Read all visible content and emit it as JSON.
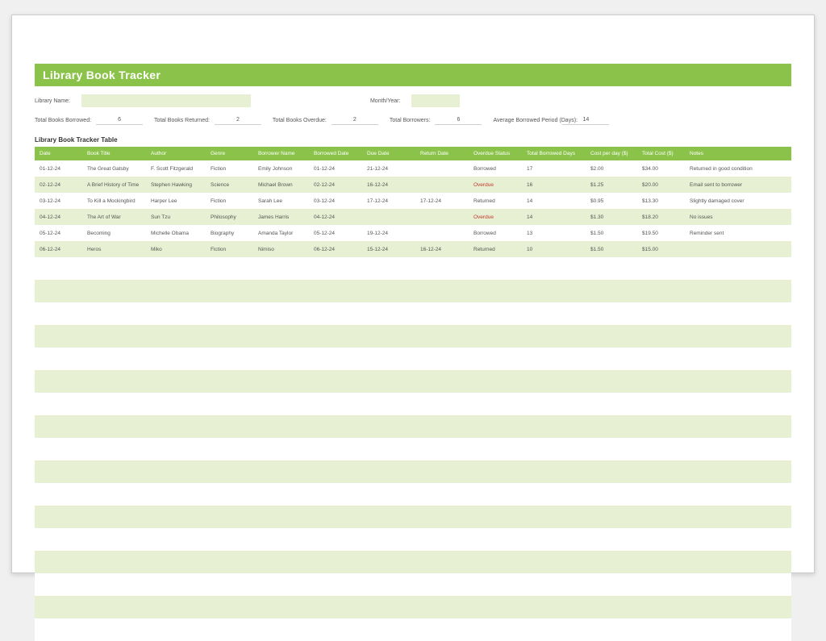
{
  "title": "Library Book Tracker",
  "info": {
    "library_name_label": "Library Name:",
    "library_name_value": "",
    "month_year_label": "Month/Year:",
    "month_year_value": ""
  },
  "stats": {
    "total_borrowed_label": "Total Books Borrowed:",
    "total_borrowed_value": "6",
    "total_returned_label": "Total Books Returned:",
    "total_returned_value": "2",
    "total_overdue_label": "Total Books Overdue:",
    "total_overdue_value": "2",
    "total_borrowers_label": "Total Borrowers:",
    "total_borrowers_value": "6",
    "avg_period_label": "Average Borrowed Period (Days):",
    "avg_period_value": "14"
  },
  "table_title": "Library Book Tracker Table",
  "columns": {
    "date": "Date",
    "title": "Book Title",
    "author": "Author",
    "genre": "Genre",
    "borrower": "Borrower Name",
    "borrowed_date": "Borrowed Date",
    "due_date": "Due Date",
    "return_date": "Return Date",
    "overdue_status": "Overdue Status",
    "borrowed_days": "Total Borrowed Days",
    "cost_per_day": "Cost per day ($)",
    "total_cost": "Total Cost ($)",
    "notes": "Notes"
  },
  "rows": [
    {
      "date": "01-12-24",
      "title": "The Great Gatsby",
      "author": "F. Scott Fitzgerald",
      "genre": "Fiction",
      "borrower": "Emily Johnson",
      "bdate": "01-12-24",
      "ddate": "21-12-24",
      "rdate": "",
      "status": "Borrowed",
      "days": "17",
      "cost": "$2.00",
      "total": "$34.00",
      "notes": "Returned in good condition"
    },
    {
      "date": "02-12-24",
      "title": "A Brief History of Time",
      "author": "Stephen Hawking",
      "genre": "Science",
      "borrower": "Michael Brown",
      "bdate": "02-12-24",
      "ddate": "16-12-24",
      "rdate": "",
      "status": "Overdue",
      "days": "16",
      "cost": "$1.25",
      "total": "$20.00",
      "notes": "Email sent to borrower"
    },
    {
      "date": "03-12-24",
      "title": "To Kill a Mockingbird",
      "author": "Harper Lee",
      "genre": "Fiction",
      "borrower": "Sarah Lee",
      "bdate": "03-12-24",
      "ddate": "17-12-24",
      "rdate": "17-12-24",
      "status": "Returned",
      "days": "14",
      "cost": "$0.95",
      "total": "$13.30",
      "notes": "Slightly damaged cover"
    },
    {
      "date": "04-12-24",
      "title": "The Art of War",
      "author": "Sun Tzu",
      "genre": "Philosophy",
      "borrower": "James Harris",
      "bdate": "04-12-24",
      "ddate": "",
      "rdate": "",
      "status": "Overdue",
      "days": "14",
      "cost": "$1.30",
      "total": "$18.20",
      "notes": "No issues"
    },
    {
      "date": "05-12-24",
      "title": "Becoming",
      "author": "Michelle Obama",
      "genre": "Biography",
      "borrower": "Amanda Taylor",
      "bdate": "05-12-24",
      "ddate": "19-12-24",
      "rdate": "",
      "status": "Borrowed",
      "days": "13",
      "cost": "$1.50",
      "total": "$19.50",
      "notes": "Reminder sent"
    },
    {
      "date": "06-12-24",
      "title": "Heros",
      "author": "Miko",
      "genre": "Fiction",
      "borrower": "Nimiso",
      "bdate": "06-12-24",
      "ddate": "15-12-24",
      "rdate": "16-12-24",
      "status": "Returned",
      "days": "10",
      "cost": "$1.50",
      "total": "$15.00",
      "notes": ""
    }
  ],
  "empty_rows": 17
}
